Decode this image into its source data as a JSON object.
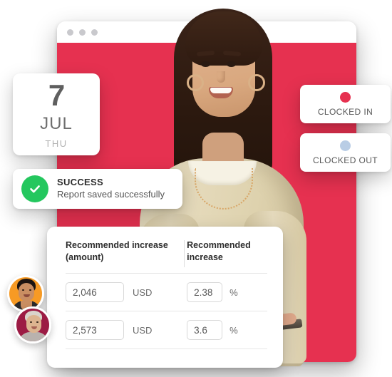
{
  "browser": {
    "traffic_lights": [
      "dot-1",
      "dot-2",
      "dot-3"
    ],
    "accent_color": "#E63150"
  },
  "calendar": {
    "day": "7",
    "month": "JUL",
    "weekday": "THU"
  },
  "status_cards": [
    {
      "label": "CLOCKED IN",
      "dot_color": "#E63150",
      "icon": "status-dot-icon"
    },
    {
      "label": "CLOCKED OUT",
      "dot_color": "#B9CDE5",
      "icon": "status-dot-icon"
    }
  ],
  "toast": {
    "icon": "check-circle-icon",
    "icon_color": "#24C75E",
    "title": "SUCCESS",
    "message": "Report saved successfully"
  },
  "table": {
    "columns": [
      "Recommended increase (amount)",
      "Recommended increase"
    ],
    "rows": [
      {
        "amount": "2,046",
        "currency": "USD",
        "percent": "2.38",
        "percent_unit": "%"
      },
      {
        "amount": "2,573",
        "currency": "USD",
        "percent": "3.6",
        "percent_unit": "%"
      }
    ]
  },
  "avatars": [
    {
      "name": "avatar-employee-1",
      "background": "#F79A24"
    },
    {
      "name": "avatar-employee-2",
      "background": "#9C1B44"
    }
  ],
  "hero": {
    "alt": "smiling-employee-photo"
  }
}
